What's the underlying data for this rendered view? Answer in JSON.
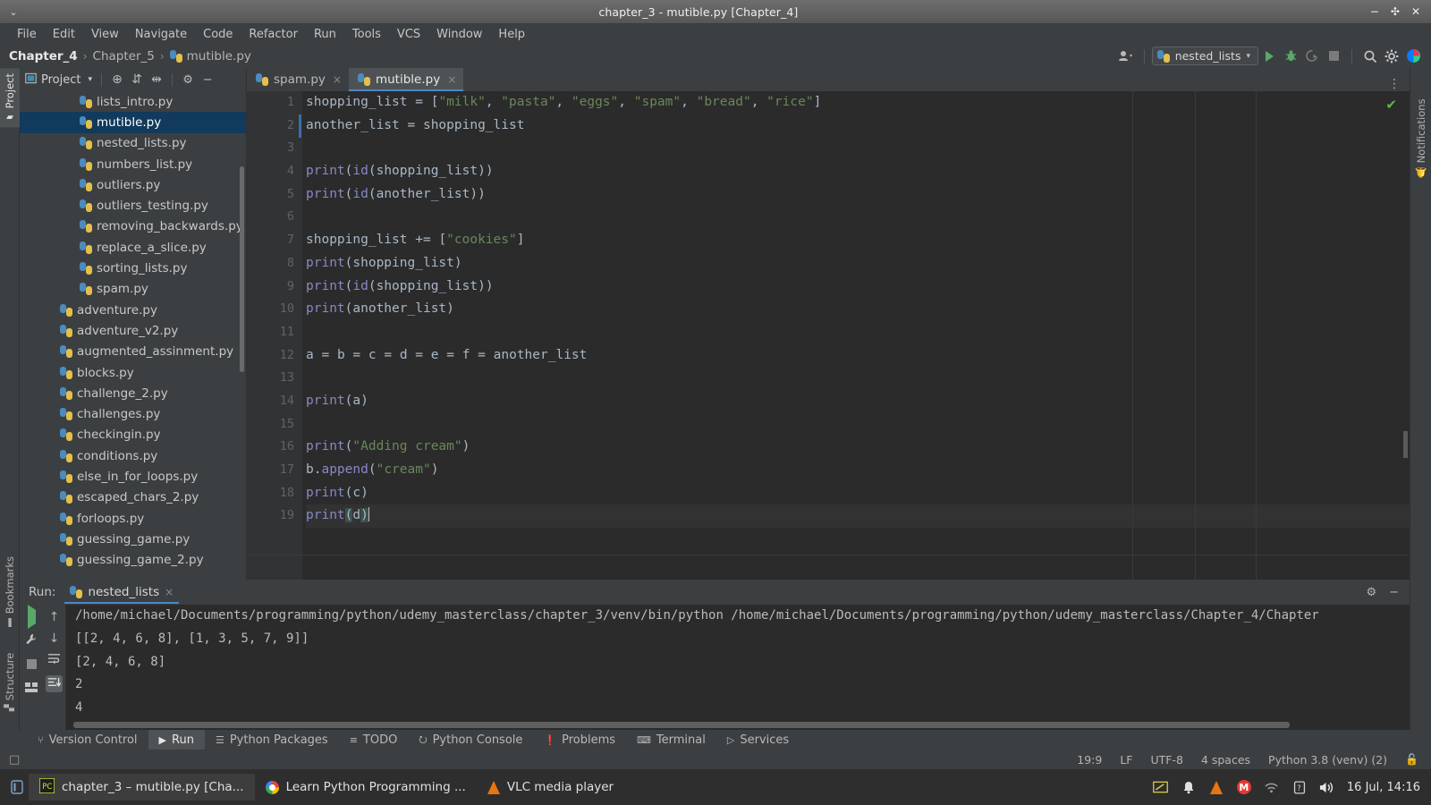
{
  "window": {
    "title": "chapter_3 - mutible.py [Chapter_4]",
    "minimize": "−",
    "maximize": "✣",
    "close": "✕",
    "menu_chevron": "⌄"
  },
  "menubar": [
    {
      "label": "File"
    },
    {
      "label": "Edit"
    },
    {
      "label": "View"
    },
    {
      "label": "Navigate"
    },
    {
      "label": "Code"
    },
    {
      "label": "Refactor"
    },
    {
      "label": "Run"
    },
    {
      "label": "Tools"
    },
    {
      "label": "VCS"
    },
    {
      "label": "Window"
    },
    {
      "label": "Help"
    }
  ],
  "breadcrumb": {
    "separator": "›",
    "items": [
      "Chapter_4",
      "Chapter_5",
      "mutible.py"
    ]
  },
  "navbar_right": {
    "account_label": "▾",
    "run_config": "nested_lists",
    "run_config_caret": "▾",
    "run_button": "▶",
    "debug_button": "🐞",
    "coverage_button": "▷",
    "stop_button": "■",
    "search_button": "⚲",
    "settings_button": "⚙"
  },
  "left_strip": [
    {
      "label": "Project",
      "active": true
    },
    {
      "label": "Bookmarks",
      "active": false
    },
    {
      "label": "Structure",
      "active": false
    }
  ],
  "right_strip": [
    {
      "label": "Notifications",
      "active": false
    }
  ],
  "project_panel": {
    "title": "Project",
    "caret": "▾",
    "locate_icon": "⊕",
    "expand_icon": "⇵",
    "collapse_icon": "⇹",
    "settings_icon": "⚙",
    "hide_icon": "−",
    "tree": [
      {
        "label": "lists_intro.py",
        "indent": 1,
        "selected": false
      },
      {
        "label": "mutible.py",
        "indent": 1,
        "selected": true
      },
      {
        "label": "nested_lists.py",
        "indent": 1,
        "selected": false
      },
      {
        "label": "numbers_list.py",
        "indent": 1,
        "selected": false
      },
      {
        "label": "outliers.py",
        "indent": 1,
        "selected": false
      },
      {
        "label": "outliers_testing.py",
        "indent": 1,
        "selected": false
      },
      {
        "label": "removing_backwards.py",
        "indent": 1,
        "selected": false
      },
      {
        "label": "replace_a_slice.py",
        "indent": 1,
        "selected": false
      },
      {
        "label": "sorting_lists.py",
        "indent": 1,
        "selected": false
      },
      {
        "label": "spam.py",
        "indent": 1,
        "selected": false
      },
      {
        "label": "adventure.py",
        "indent": 0,
        "selected": false
      },
      {
        "label": "adventure_v2.py",
        "indent": 0,
        "selected": false
      },
      {
        "label": "augmented_assinment.py",
        "indent": 0,
        "selected": false
      },
      {
        "label": "blocks.py",
        "indent": 0,
        "selected": false
      },
      {
        "label": "challenge_2.py",
        "indent": 0,
        "selected": false
      },
      {
        "label": "challenges.py",
        "indent": 0,
        "selected": false
      },
      {
        "label": "checkingin.py",
        "indent": 0,
        "selected": false
      },
      {
        "label": "conditions.py",
        "indent": 0,
        "selected": false
      },
      {
        "label": "else_in_for_loops.py",
        "indent": 0,
        "selected": false
      },
      {
        "label": "escaped_chars_2.py",
        "indent": 0,
        "selected": false
      },
      {
        "label": "forloops.py",
        "indent": 0,
        "selected": false
      },
      {
        "label": "guessing_game.py",
        "indent": 0,
        "selected": false
      },
      {
        "label": "guessing_game_2.py",
        "indent": 0,
        "selected": false
      }
    ]
  },
  "editor": {
    "tabs": [
      {
        "label": "spam.py",
        "active": false,
        "close": "×"
      },
      {
        "label": "mutible.py",
        "active": true,
        "close": "×"
      }
    ],
    "more_icon": "⋮",
    "inspection_ok": "✔",
    "line_numbers": [
      1,
      2,
      3,
      4,
      5,
      6,
      7,
      8,
      9,
      10,
      11,
      12,
      13,
      14,
      15,
      16,
      17,
      18,
      19
    ],
    "cursor_line": 19,
    "code": [
      {
        "n": 1,
        "text": "shopping_list = [\"milk\", \"pasta\", \"eggs\", \"spam\", \"bread\", \"rice\"]"
      },
      {
        "n": 2,
        "text": "another_list = shopping_list"
      },
      {
        "n": 3,
        "text": ""
      },
      {
        "n": 4,
        "text": "print(id(shopping_list))"
      },
      {
        "n": 5,
        "text": "print(id(another_list))"
      },
      {
        "n": 6,
        "text": ""
      },
      {
        "n": 7,
        "text": "shopping_list += [\"cookies\"]"
      },
      {
        "n": 8,
        "text": "print(shopping_list)"
      },
      {
        "n": 9,
        "text": "print(id(shopping_list))"
      },
      {
        "n": 10,
        "text": "print(another_list)"
      },
      {
        "n": 11,
        "text": ""
      },
      {
        "n": 12,
        "text": "a = b = c = d = e = f = another_list"
      },
      {
        "n": 13,
        "text": ""
      },
      {
        "n": 14,
        "text": "print(a)"
      },
      {
        "n": 15,
        "text": ""
      },
      {
        "n": 16,
        "text": "print(\"Adding cream\")"
      },
      {
        "n": 17,
        "text": "b.append(\"cream\")"
      },
      {
        "n": 18,
        "text": "print(c)"
      },
      {
        "n": 19,
        "text": "print(d)"
      }
    ]
  },
  "run_panel": {
    "label": "Run:",
    "tab_label": "nested_lists",
    "tab_close": "×",
    "settings_icon": "⚙",
    "hide_icon": "−",
    "tools": {
      "rerun": "▶",
      "wrench": "🔧",
      "stop": "■",
      "layout": "▤",
      "up": "↑",
      "down": "↓",
      "soft_wrap": "↩",
      "scroll_end": "↧"
    },
    "output": [
      "/home/michael/Documents/programming/python/udemy_masterclass/chapter_3/venv/bin/python /home/michael/Documents/programming/python/udemy_masterclass/Chapter_4/Chapter",
      "[[2, 4, 6, 8], [1, 3, 5, 7, 9]]",
      "[2, 4, 6, 8]",
      "2",
      "4"
    ]
  },
  "bottom_bar": [
    {
      "label": "Version Control",
      "icon": "⑂",
      "active": false
    },
    {
      "label": "Run",
      "icon": "▶",
      "active": true
    },
    {
      "label": "Python Packages",
      "icon": "☰",
      "active": false
    },
    {
      "label": "TODO",
      "icon": "≡",
      "active": false
    },
    {
      "label": "Python Console",
      "icon": "⭮",
      "active": false
    },
    {
      "label": "Problems",
      "icon": "❗",
      "active": false
    },
    {
      "label": "Terminal",
      "icon": "⌨",
      "active": false
    },
    {
      "label": "Services",
      "icon": "▷",
      "active": false
    }
  ],
  "status_bar": {
    "left_icon": "□",
    "position": "19:9",
    "line_sep": "LF",
    "encoding": "UTF-8",
    "indent": "4 spaces",
    "interpreter": "Python 3.8 (venv) (2)",
    "lock_icon": "🔓"
  },
  "taskbar": {
    "start_icon": "☰",
    "tasks": [
      {
        "label": "chapter_3 – mutible.py [Cha...",
        "icon": "pycharm-icon",
        "active": true
      },
      {
        "label": "Learn Python Programming ...",
        "icon": "chrome-icon",
        "active": false
      },
      {
        "label": "VLC media player",
        "icon": "vlc-icon",
        "active": false
      }
    ],
    "tray": {
      "keyboard_icon": "✐",
      "bell_icon": "🔔",
      "vlc_icon": "vlc-cone",
      "gmail_icon": "M",
      "wifi_icon": "◠",
      "battery_icon": "?",
      "volume_icon": "🔊",
      "clock": "16 Jul, 14:16"
    }
  },
  "colors": {
    "panel_bg": "#3c3f41",
    "editor_bg": "#2b2b2b",
    "selection_blue": "#113a5c",
    "accent_blue": "#4a88c7",
    "green_run": "#59a869",
    "keyword_orange": "#cc7832",
    "string_green": "#6a8759",
    "function_purple": "#8888c6",
    "text_default": "#a9b7c6"
  }
}
